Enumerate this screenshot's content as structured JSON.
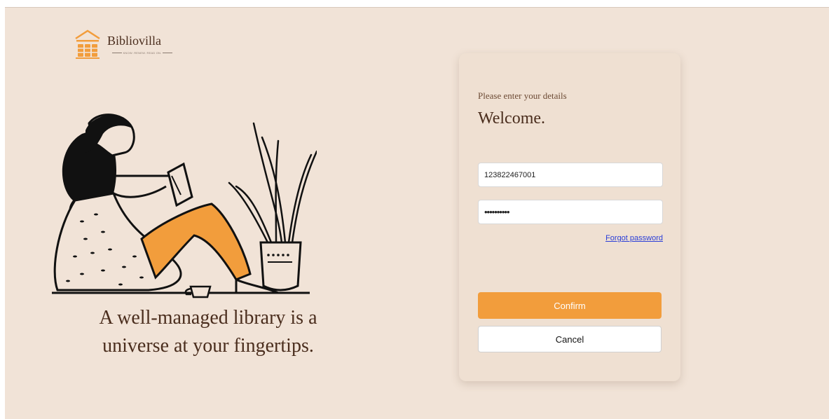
{
  "brand": {
    "name": "Bibliovilla",
    "tagline": "KNOW. RENEW. READ ON.",
    "logo_icon": "library-building-icon",
    "accent_color": "#f29d3c"
  },
  "hero": {
    "illustration_icon": "woman-reading-illustration",
    "quote_line1": "A well-managed library is a",
    "quote_line2": "universe at your fingertips."
  },
  "login": {
    "subtitle": "Please enter your details",
    "title": "Welcome.",
    "username_value": "123822467001",
    "password_value": "••••••••••",
    "forgot_label": "Forgot password",
    "confirm_label": "Confirm",
    "cancel_label": "Cancel"
  }
}
